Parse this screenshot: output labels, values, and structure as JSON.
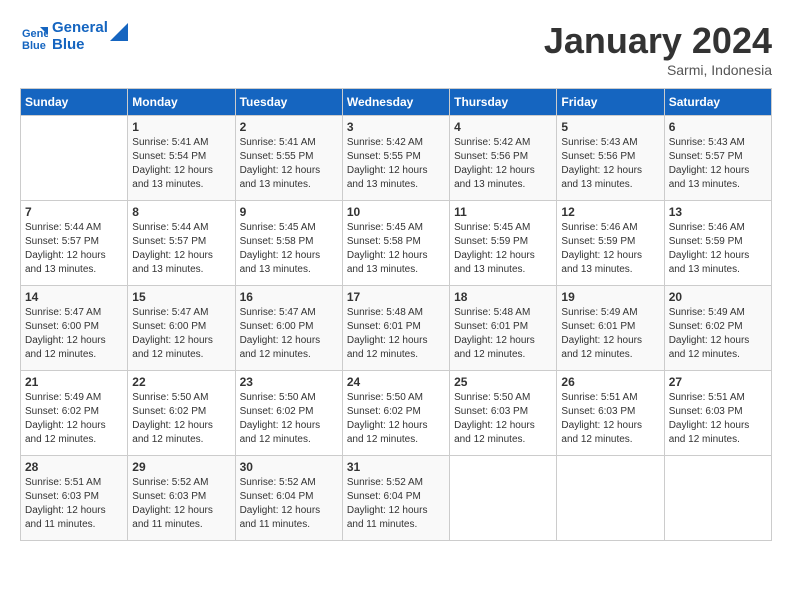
{
  "header": {
    "logo_line1": "General",
    "logo_line2": "Blue",
    "month_year": "January 2024",
    "location": "Sarmi, Indonesia"
  },
  "days_of_week": [
    "Sunday",
    "Monday",
    "Tuesday",
    "Wednesday",
    "Thursday",
    "Friday",
    "Saturday"
  ],
  "weeks": [
    [
      {
        "day": "",
        "info": ""
      },
      {
        "day": "1",
        "info": "Sunrise: 5:41 AM\nSunset: 5:54 PM\nDaylight: 12 hours\nand 13 minutes."
      },
      {
        "day": "2",
        "info": "Sunrise: 5:41 AM\nSunset: 5:55 PM\nDaylight: 12 hours\nand 13 minutes."
      },
      {
        "day": "3",
        "info": "Sunrise: 5:42 AM\nSunset: 5:55 PM\nDaylight: 12 hours\nand 13 minutes."
      },
      {
        "day": "4",
        "info": "Sunrise: 5:42 AM\nSunset: 5:56 PM\nDaylight: 12 hours\nand 13 minutes."
      },
      {
        "day": "5",
        "info": "Sunrise: 5:43 AM\nSunset: 5:56 PM\nDaylight: 12 hours\nand 13 minutes."
      },
      {
        "day": "6",
        "info": "Sunrise: 5:43 AM\nSunset: 5:57 PM\nDaylight: 12 hours\nand 13 minutes."
      }
    ],
    [
      {
        "day": "7",
        "info": "Sunrise: 5:44 AM\nSunset: 5:57 PM\nDaylight: 12 hours\nand 13 minutes."
      },
      {
        "day": "8",
        "info": "Sunrise: 5:44 AM\nSunset: 5:57 PM\nDaylight: 12 hours\nand 13 minutes."
      },
      {
        "day": "9",
        "info": "Sunrise: 5:45 AM\nSunset: 5:58 PM\nDaylight: 12 hours\nand 13 minutes."
      },
      {
        "day": "10",
        "info": "Sunrise: 5:45 AM\nSunset: 5:58 PM\nDaylight: 12 hours\nand 13 minutes."
      },
      {
        "day": "11",
        "info": "Sunrise: 5:45 AM\nSunset: 5:59 PM\nDaylight: 12 hours\nand 13 minutes."
      },
      {
        "day": "12",
        "info": "Sunrise: 5:46 AM\nSunset: 5:59 PM\nDaylight: 12 hours\nand 13 minutes."
      },
      {
        "day": "13",
        "info": "Sunrise: 5:46 AM\nSunset: 5:59 PM\nDaylight: 12 hours\nand 13 minutes."
      }
    ],
    [
      {
        "day": "14",
        "info": "Sunrise: 5:47 AM\nSunset: 6:00 PM\nDaylight: 12 hours\nand 12 minutes."
      },
      {
        "day": "15",
        "info": "Sunrise: 5:47 AM\nSunset: 6:00 PM\nDaylight: 12 hours\nand 12 minutes."
      },
      {
        "day": "16",
        "info": "Sunrise: 5:47 AM\nSunset: 6:00 PM\nDaylight: 12 hours\nand 12 minutes."
      },
      {
        "day": "17",
        "info": "Sunrise: 5:48 AM\nSunset: 6:01 PM\nDaylight: 12 hours\nand 12 minutes."
      },
      {
        "day": "18",
        "info": "Sunrise: 5:48 AM\nSunset: 6:01 PM\nDaylight: 12 hours\nand 12 minutes."
      },
      {
        "day": "19",
        "info": "Sunrise: 5:49 AM\nSunset: 6:01 PM\nDaylight: 12 hours\nand 12 minutes."
      },
      {
        "day": "20",
        "info": "Sunrise: 5:49 AM\nSunset: 6:02 PM\nDaylight: 12 hours\nand 12 minutes."
      }
    ],
    [
      {
        "day": "21",
        "info": "Sunrise: 5:49 AM\nSunset: 6:02 PM\nDaylight: 12 hours\nand 12 minutes."
      },
      {
        "day": "22",
        "info": "Sunrise: 5:50 AM\nSunset: 6:02 PM\nDaylight: 12 hours\nand 12 minutes."
      },
      {
        "day": "23",
        "info": "Sunrise: 5:50 AM\nSunset: 6:02 PM\nDaylight: 12 hours\nand 12 minutes."
      },
      {
        "day": "24",
        "info": "Sunrise: 5:50 AM\nSunset: 6:02 PM\nDaylight: 12 hours\nand 12 minutes."
      },
      {
        "day": "25",
        "info": "Sunrise: 5:50 AM\nSunset: 6:03 PM\nDaylight: 12 hours\nand 12 minutes."
      },
      {
        "day": "26",
        "info": "Sunrise: 5:51 AM\nSunset: 6:03 PM\nDaylight: 12 hours\nand 12 minutes."
      },
      {
        "day": "27",
        "info": "Sunrise: 5:51 AM\nSunset: 6:03 PM\nDaylight: 12 hours\nand 12 minutes."
      }
    ],
    [
      {
        "day": "28",
        "info": "Sunrise: 5:51 AM\nSunset: 6:03 PM\nDaylight: 12 hours\nand 11 minutes."
      },
      {
        "day": "29",
        "info": "Sunrise: 5:52 AM\nSunset: 6:03 PM\nDaylight: 12 hours\nand 11 minutes."
      },
      {
        "day": "30",
        "info": "Sunrise: 5:52 AM\nSunset: 6:04 PM\nDaylight: 12 hours\nand 11 minutes."
      },
      {
        "day": "31",
        "info": "Sunrise: 5:52 AM\nSunset: 6:04 PM\nDaylight: 12 hours\nand 11 minutes."
      },
      {
        "day": "",
        "info": ""
      },
      {
        "day": "",
        "info": ""
      },
      {
        "day": "",
        "info": ""
      }
    ]
  ]
}
